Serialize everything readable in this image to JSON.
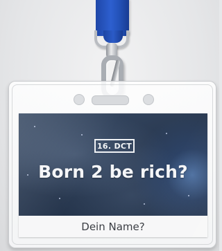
{
  "badge": {
    "date": "16. DCT",
    "headline": "Born 2 be rich?",
    "name_placeholder": "Dein Name?"
  },
  "colors": {
    "lanyard": "#2552bd",
    "card_background": "#2a3a52",
    "card_text": "#f5f6f8",
    "name_text": "#3b3e44"
  },
  "icons": {
    "clip": "lanyard-clip-icon"
  }
}
